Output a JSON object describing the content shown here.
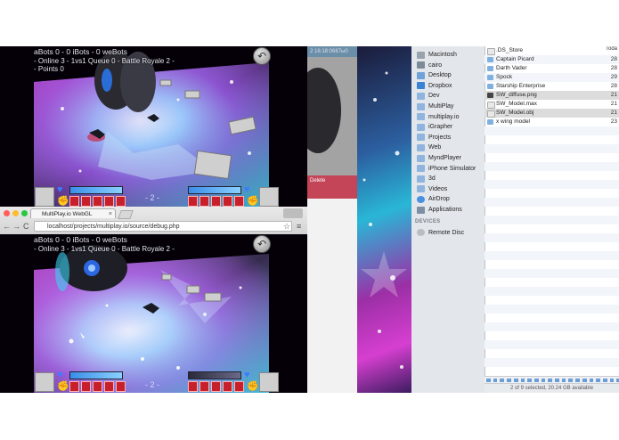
{
  "game_top": {
    "stats_line": "aBots 0 - 0 iBots - 0 weBots",
    "queue_line": "- Online 3 - 1vs1 Queue 0 - Battle Royale 2 -",
    "points_line": "- Points 0",
    "page_label": "- 2 -",
    "exit_glyph": "↶"
  },
  "game_bottom": {
    "stats_line": "aBots 0 - 0 iBots - 0 weBots",
    "queue_line": "- Online 3 - 1vs1 Queue 0 - Battle Royale 2 -",
    "page_label": "- 2 -",
    "exit_glyph": "↶"
  },
  "browser": {
    "tab_title": "MultiPlay.io WebGL",
    "tab_close": "×",
    "url": "localhost/projects/multiplay.io/source/debug.php",
    "back_glyph": "←",
    "forward_glyph": "→",
    "reload_glyph": "C",
    "menu_glyph": "≡",
    "star_glyph": "☆",
    "colors": {
      "close": "#ff5f57",
      "minimize": "#febc2e",
      "zoom": "#28c840"
    }
  },
  "mid_pane": {
    "top_text": "2 16:18:0687ы0",
    "red_label": "Delete"
  },
  "finder": {
    "sidebar_items": [
      {
        "label": "Macintosh",
        "icon": "hard-drive-icon"
      },
      {
        "label": "cairo",
        "icon": "home-icon"
      },
      {
        "label": "Desktop",
        "icon": "desktop-folder-icon"
      },
      {
        "label": "Dropbox",
        "icon": "dropbox-icon"
      },
      {
        "label": "Dev",
        "icon": "folder-icon"
      },
      {
        "label": "MultiPlay",
        "icon": "folder-icon"
      },
      {
        "label": "multiplay.io",
        "icon": "folder-icon"
      },
      {
        "label": "iGrapher",
        "icon": "folder-icon"
      },
      {
        "label": "Projects",
        "icon": "folder-icon"
      },
      {
        "label": "Web",
        "icon": "folder-icon"
      },
      {
        "label": "MyndPlayer",
        "icon": "folder-icon"
      },
      {
        "label": "iPhone Simulator",
        "icon": "folder-icon"
      },
      {
        "label": "3d",
        "icon": "folder-icon"
      },
      {
        "label": "Videos",
        "icon": "folder-icon"
      },
      {
        "label": "AirDrop",
        "icon": "airdrop-icon"
      },
      {
        "label": "Applications",
        "icon": "applications-icon"
      }
    ],
    "devices_header": "DEVICES",
    "devices": [
      {
        "label": "Remote Disc",
        "icon": "disc-icon"
      }
    ],
    "column_header": "Toda",
    "files": [
      {
        "name": ".DS_Store",
        "date": "",
        "kind": "file",
        "selected": false
      },
      {
        "name": "Captain Picard",
        "date": "28",
        "kind": "folder",
        "selected": false
      },
      {
        "name": "Darth Vader",
        "date": "28",
        "kind": "folder",
        "selected": false
      },
      {
        "name": "Spock",
        "date": "29",
        "kind": "folder",
        "selected": false
      },
      {
        "name": "Starship Enterprise",
        "date": "28",
        "kind": "folder",
        "selected": false
      },
      {
        "name": "SW_diffuse.png",
        "date": "21",
        "kind": "image",
        "selected": true
      },
      {
        "name": "SW_Model.max",
        "date": "21",
        "kind": "file",
        "selected": false
      },
      {
        "name": "SW_Model.obj",
        "date": "21",
        "kind": "file",
        "selected": true
      },
      {
        "name": "x wing model",
        "date": "23",
        "kind": "folder",
        "selected": false
      }
    ],
    "status": "2 of 9 selected, 20.24 GB available"
  }
}
